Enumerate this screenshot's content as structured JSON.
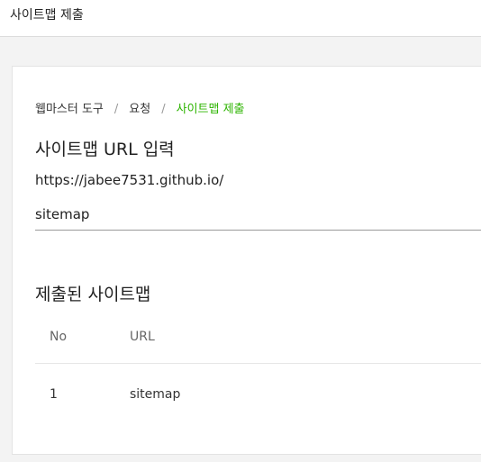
{
  "header": {
    "title": "사이트맵 제출"
  },
  "breadcrumb": {
    "items": [
      "웹마스터 도구",
      "요청",
      "사이트맵 제출"
    ],
    "separator": "/",
    "active_color": "#2db400"
  },
  "url_section": {
    "title": "사이트맵 URL 입력",
    "site_url": "https://jabee7531.github.io/",
    "input_value": "sitemap"
  },
  "submitted_section": {
    "title": "제출된 사이트맵",
    "columns": [
      "No",
      "URL"
    ],
    "rows": [
      {
        "no": "1",
        "url": "sitemap"
      }
    ]
  }
}
